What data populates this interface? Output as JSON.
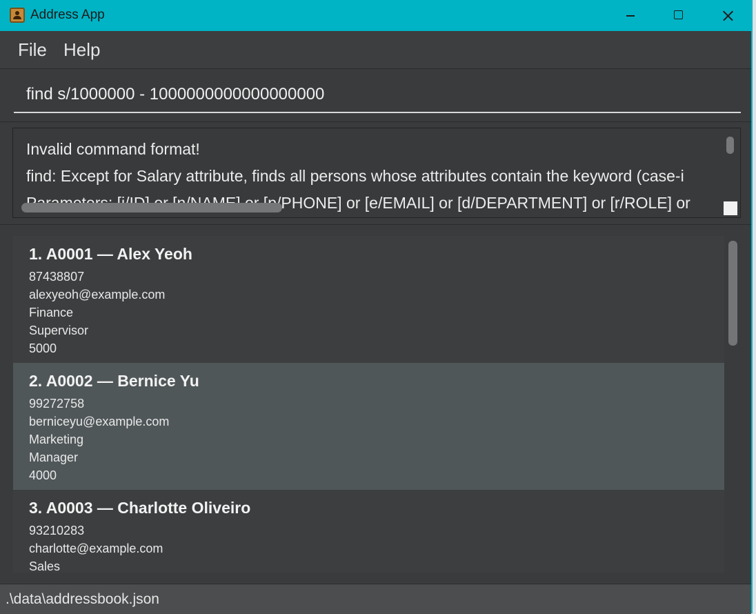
{
  "window": {
    "title": "Address App"
  },
  "menu": {
    "file": "File",
    "help": "Help"
  },
  "command": {
    "value": "find s/1000000 - 1000000000000000000"
  },
  "result": {
    "lines": [
      "Invalid command format!",
      "find: Except for Salary attribute, finds all persons whose attributes contain the keyword (case-i",
      "Parameters: [i/ID] or [n/NAME] or [p/PHONE] or [e/EMAIL] or [d/DEPARTMENT] or [r/ROLE] or"
    ]
  },
  "persons": [
    {
      "header": "1.  A0001 — Alex Yeoh",
      "phone": "87438807",
      "email": "alexyeoh@example.com",
      "department": "Finance",
      "role": "Supervisor",
      "salary": "5000"
    },
    {
      "header": "2.  A0002 — Bernice Yu",
      "phone": "99272758",
      "email": "berniceyu@example.com",
      "department": "Marketing",
      "role": "Manager",
      "salary": "4000"
    },
    {
      "header": "3.  A0003 — Charlotte Oliveiro",
      "phone": "93210283",
      "email": "charlotte@example.com",
      "department": "Sales"
    }
  ],
  "status": {
    "path": ".\\data\\addressbook.json"
  },
  "colors": {
    "titlebar": "#00b4c5",
    "selected_card": "#505759",
    "window_bg": "#3a3b3d"
  }
}
